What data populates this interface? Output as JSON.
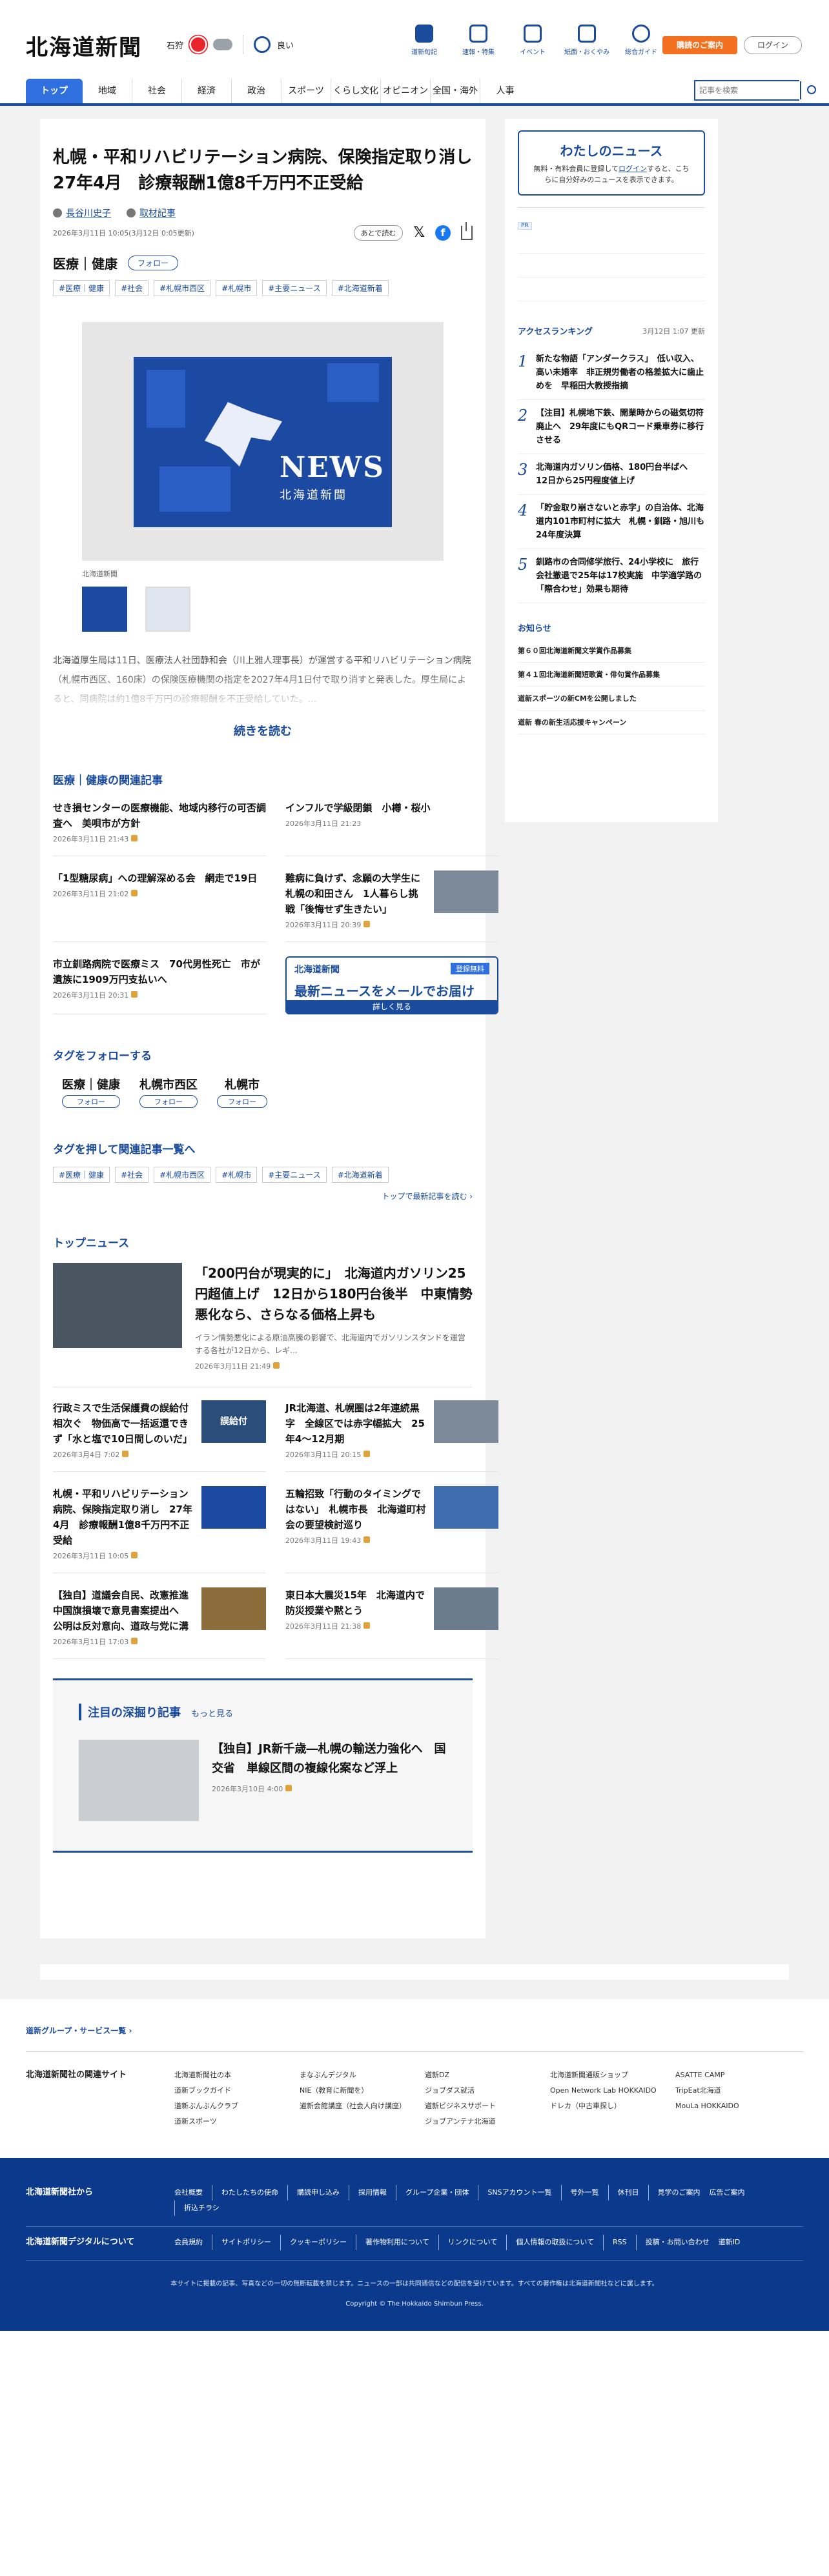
{
  "header": {
    "logo": "北海道新聞",
    "weather_city": "石狩",
    "weather_status": "良い",
    "nav": [
      {
        "label": "道新旬記",
        "icon": "newspaper-icon"
      },
      {
        "label": "速報・特集",
        "icon": "flag-icon"
      },
      {
        "label": "イベント",
        "icon": "calendar-icon"
      },
      {
        "label": "紙面・おくやみ",
        "icon": "paper-icon"
      },
      {
        "label": "総合ガイド",
        "icon": "help-icon"
      }
    ],
    "guide_button": "購読のご案内",
    "login_button": "ログイン"
  },
  "gnav": {
    "items": [
      "トップ",
      "地域",
      "社会",
      "経済",
      "政治",
      "スポーツ",
      "くらし文化",
      "オピニオン",
      "全国・海外",
      "人事"
    ],
    "search_placeholder": "記事を検索"
  },
  "article": {
    "title": "札幌・平和リハビリテーション病院、保険指定取り消し　27年4月　診療報酬1億8千万円不正受給",
    "author": "長谷川史子",
    "author_extra": "取材記事",
    "dates": "2026年3月11日 10:05(3月12日 0:05更新)",
    "later_button": "あとで読む",
    "category": "医療｜健康",
    "follow_label": "フォロー",
    "tags": [
      "#医療｜健康",
      "#社会",
      "#札幌市西区",
      "#札幌市",
      "#主要ニュース",
      "#北海道新着"
    ],
    "image_overlay_big": "NEWS",
    "image_overlay_small": "北海道新聞",
    "caption": "北海道新聞",
    "lead": "北海道厚生局は11日、医療法人社団静和会（川上雅人理事長）が運営する平和リハビリテーション病院（札幌市西区、160床）の保険医療機関の指定を2027年4月1日付で取り消すと発表した。厚生局によると、同病院は約1億8千万円の診療報酬を不正受給していた。...",
    "read_more": "続きを読む"
  },
  "related": {
    "heading": "医療｜健康の関連記事",
    "items": [
      {
        "title": "せき損センターの医療機能、地域内移行の可否調査へ　美唄市が方針",
        "date": "2026年3月11日 21:43"
      },
      {
        "title": "インフルで学級閉鎖　小樽・桜小",
        "date": "2026年3月11日 21:23"
      },
      {
        "title": "「1型糖尿病」への理解深める会　網走で19日",
        "date": "2026年3月11日 21:02"
      },
      {
        "title": "難病に負けず、念願の大学生に　札幌の和田さん　1人暮らし挑戦「後悔せず生きたい」",
        "date": "2026年3月11日 20:39"
      },
      {
        "title": "市立釧路病院で医療ミス　70代男性死亡　市が遺族に1909万円支払いへ",
        "date": "2026年3月11日 20:31"
      }
    ],
    "mail_banner": {
      "brand": "北海道新聞",
      "badge": "登録無料",
      "headline": "最新ニュースをメールでお届け",
      "cta": "詳しく見る"
    }
  },
  "tag_follow": {
    "heading": "タグをフォローする",
    "items": [
      "医療｜健康",
      "札幌市西区",
      "札幌市"
    ],
    "follow_label": "フォロー"
  },
  "tag_related": {
    "heading": "タグを押して関連記事一覧へ",
    "tags": [
      "#医療｜健康",
      "#社会",
      "#札幌市西区",
      "#札幌市",
      "#主要ニュース",
      "#北海道新着"
    ],
    "link": "トップで最新記事を読む"
  },
  "top_news": {
    "heading": "トップニュース",
    "feature": {
      "title": "「200円台が現実的に」　北海道内ガソリン25円超値上げ　12日から180円台後半　中東情勢悪化なら、さらなる価格上昇も",
      "summary": "イラン情勢悪化による原油高騰の影響で、北海道内でガソリンスタンドを運営する各社が12日から、レギ...",
      "date": "2026年3月11日 21:49"
    },
    "items": [
      {
        "title": "行政ミスで生活保護費の誤給付相次ぐ　物価高で一括返還できず「水と塩で10日間しのいだ」",
        "date": "2026年3月4日 7:02"
      },
      {
        "title": "JR北海道、札幌圏は2年連続黒字　全線区では赤字幅拡大　25年4～12月期",
        "date": "2026年3月11日 20:15"
      },
      {
        "title": "札幌・平和リハビリテーション病院、保険指定取り消し　27年4月　診療報酬1億8千万円不正受給",
        "date": "2026年3月11日 10:05"
      },
      {
        "title": "五輪招致「行動のタイミングではない」　札幌市長　北海道町村会の要望検討巡り",
        "date": "2026年3月11日 19:43"
      },
      {
        "title": "【独自】道議会自民、改憲推進中国旗損壊で意見書案提出へ　公明は反対意向、道政与党に溝",
        "date": "2026年3月11日 17:03"
      },
      {
        "title": "東日本大震災15年　北海道内で防災授業や黙とう",
        "date": "2026年3月11日 21:38"
      }
    ],
    "thumb_label": "誤給付"
  },
  "deep": {
    "heading": "注目の深掘り記事",
    "more": "もっと見る",
    "item": {
      "title": "【独自】JR新千歳―札幌の輸送力強化へ　国交省　単線区間の複線化案など浮上",
      "date": "2026年3月10日 4:00"
    }
  },
  "sidebar": {
    "mynews_title": "わたしのニュース",
    "mynews_desc_before": "無料・有料会員に登録して",
    "mynews_link": "ログイン",
    "mynews_desc_after": "すると、こちらに自分好みのニュースを表示できます。",
    "pr_label": "PR",
    "ranking_heading": "アクセスランキング",
    "ranking_updated": "3月12日 1:07 更新",
    "ranking": [
      {
        "rank": "1",
        "title": "新たな物語「アンダークラス」　低い収入、高い未婚率　非正規労働者の格差拡大に歯止めを　早稲田大教授指摘"
      },
      {
        "rank": "2",
        "title": "【注目】札幌地下鉄、開業時からの磁気切符廃止へ　29年度にもQRコード乗車券に移行させる"
      },
      {
        "rank": "3",
        "title": "北海道内ガソリン価格、180円台半ばへ　12日から25円程度値上げ"
      },
      {
        "rank": "4",
        "title": "「貯金取り崩さないと赤字」の自治体、北海道内101市町村に拡大　札幌・釧路・旭川も　24年度決算"
      },
      {
        "rank": "5",
        "title": "釧路市の合同修学旅行、24小学校に　旅行会社撤退で25年は17校実施　中学適学路の「際合わせ」効果も期待"
      }
    ],
    "notice_heading": "お知らせ",
    "notices": [
      "第６０回北海道新聞文学賞作品募集",
      "第４１回北海道新聞短歌賞・俳句賞作品募集",
      "道新スポーツの新CMを公開しました",
      "道新 春の新生活応援キャンペーン"
    ]
  },
  "footer": {
    "group_heading": "道新グループ・サービス一覧",
    "sites_title": "北海道新聞社の関連サイト",
    "sites": [
      [
        "北海道新聞社の本",
        "道新ブックガイド",
        "道新ぶんぶんクラブ",
        "道新スポーツ"
      ],
      [
        "まなぶんデジタル",
        "NIE（教育に新聞を）",
        "道新会館講座（社会人向け講座）"
      ],
      [
        "道新DZ",
        "ジョブダス就活",
        "道新ビジネスサポート",
        "ジョブアンテナ北海道"
      ],
      [
        "北海道新聞通販ショップ",
        "Open Network Lab HOKKAIDO",
        "ドレカ（中古車探し）"
      ],
      [
        "ASATTE CAMP",
        "TripEat北海道",
        "MouLa HOKKAIDO"
      ]
    ],
    "company_title": "北海道新聞社から",
    "company_links": [
      "会社概要",
      "わたしたちの使命",
      "購読申し込み",
      "採用情報",
      "グループ企業・団体",
      "SNSアカウント一覧",
      "号外一覧",
      "休刊日",
      "見学のご案内",
      "広告ご案内",
      "折込チラシ"
    ],
    "digital_title": "北海道新聞デジタルについて",
    "digital_links": [
      "会員規約",
      "サイトポリシー",
      "クッキーポリシー",
      "著作物利用について",
      "リンクについて",
      "個人情報の取扱について",
      "RSS",
      "投稿・お問い合わせ",
      "道新ID"
    ],
    "note": "本サイトに掲載の記事、写真などの一切の無断転載を禁じます。ニュースの一部は共同通信などの配信を受けています。すべての著作権は北海道新聞社などに属します。",
    "copyright": "Copyright © The Hokkaido Shimbun Press."
  }
}
